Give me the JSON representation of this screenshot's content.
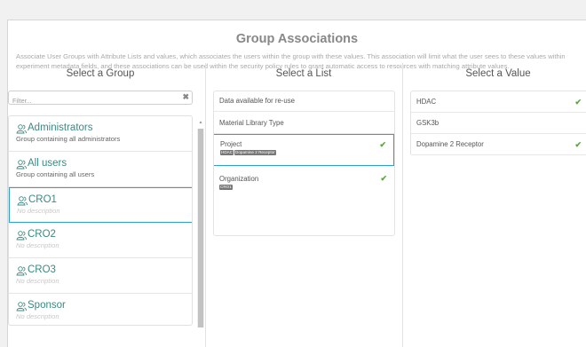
{
  "page": {
    "title": "Group Associations",
    "description": "Associate User Groups with Attribute Lists and values, which associates the users within the group with these values. This association will limit what the user sees to these values within experiment metadata fields, and these associations can be used within the security policy rules to grant automatic access to resources with matching attribute values."
  },
  "columns": {
    "group_header": "Select a Group",
    "list_header": "Select a List",
    "value_header": "Select a Value"
  },
  "filter": {
    "placeholder": "Filter...",
    "clear_label": "✖"
  },
  "groups": [
    {
      "name": "Administrators",
      "description": "Group containing all administrators"
    },
    {
      "name": "All users",
      "description": "Group containing all users"
    },
    {
      "name": "CRO1",
      "description": "No description"
    },
    {
      "name": "CRO2",
      "description": "No description"
    },
    {
      "name": "CRO3",
      "description": "No description"
    },
    {
      "name": "Sponsor",
      "description": "No description"
    }
  ],
  "lists": [
    {
      "name": "Data available for re-use"
    },
    {
      "name": "Material Library Type"
    },
    {
      "name": "Project",
      "tags": [
        "HDAC",
        "Dopamine 2 Receptor"
      ],
      "check": "✔"
    },
    {
      "name": "Organization",
      "tags": [
        "CRO1"
      ],
      "check": "✔"
    }
  ],
  "values": [
    {
      "name": "HDAC",
      "check": "✔"
    },
    {
      "name": "GSK3b"
    },
    {
      "name": "Dopamine 2 Receptor",
      "check": "✔"
    }
  ],
  "colors": {
    "accent": "#2ea0d4",
    "check": "#5ba83c",
    "group_name": "#3a8a82"
  },
  "icons": {
    "group": "users-icon",
    "check": "check-icon",
    "clear": "close-icon"
  }
}
